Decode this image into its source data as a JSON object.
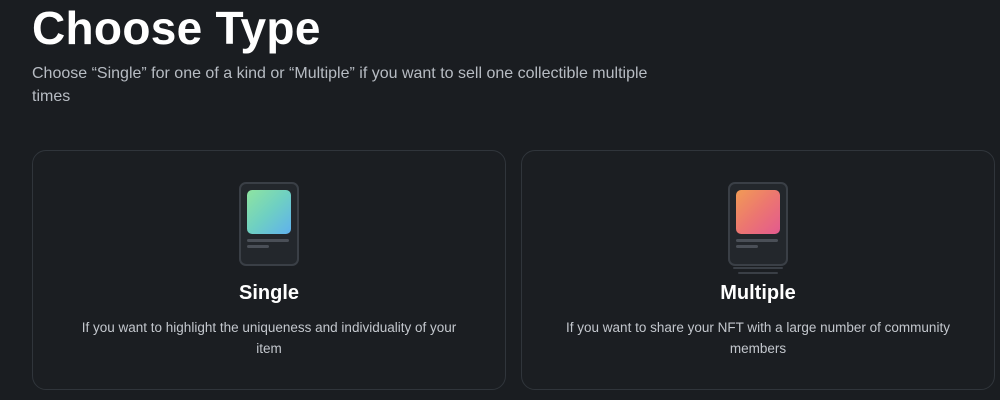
{
  "header": {
    "title": "Choose Type",
    "subtitle": "Choose “Single” for one of a kind or “Multiple” if you want to sell one collectible multiple times"
  },
  "options": [
    {
      "title": "Single",
      "description": "If you want to highlight the uniqueness and individuality of your item",
      "icon": "single-collectible-icon",
      "gradient": [
        "#8ee4a0",
        "#5fb1ee"
      ]
    },
    {
      "title": "Multiple",
      "description": "If you want to share your NFT with a large number of community members",
      "icon": "multiple-collectible-icon",
      "gradient": [
        "#f19b55",
        "#e35a8f"
      ]
    }
  ],
  "colors": {
    "background": "#1a1d21",
    "card_border": "#30353b",
    "text_primary": "#ffffff",
    "text_secondary": "#b7bcc3"
  }
}
